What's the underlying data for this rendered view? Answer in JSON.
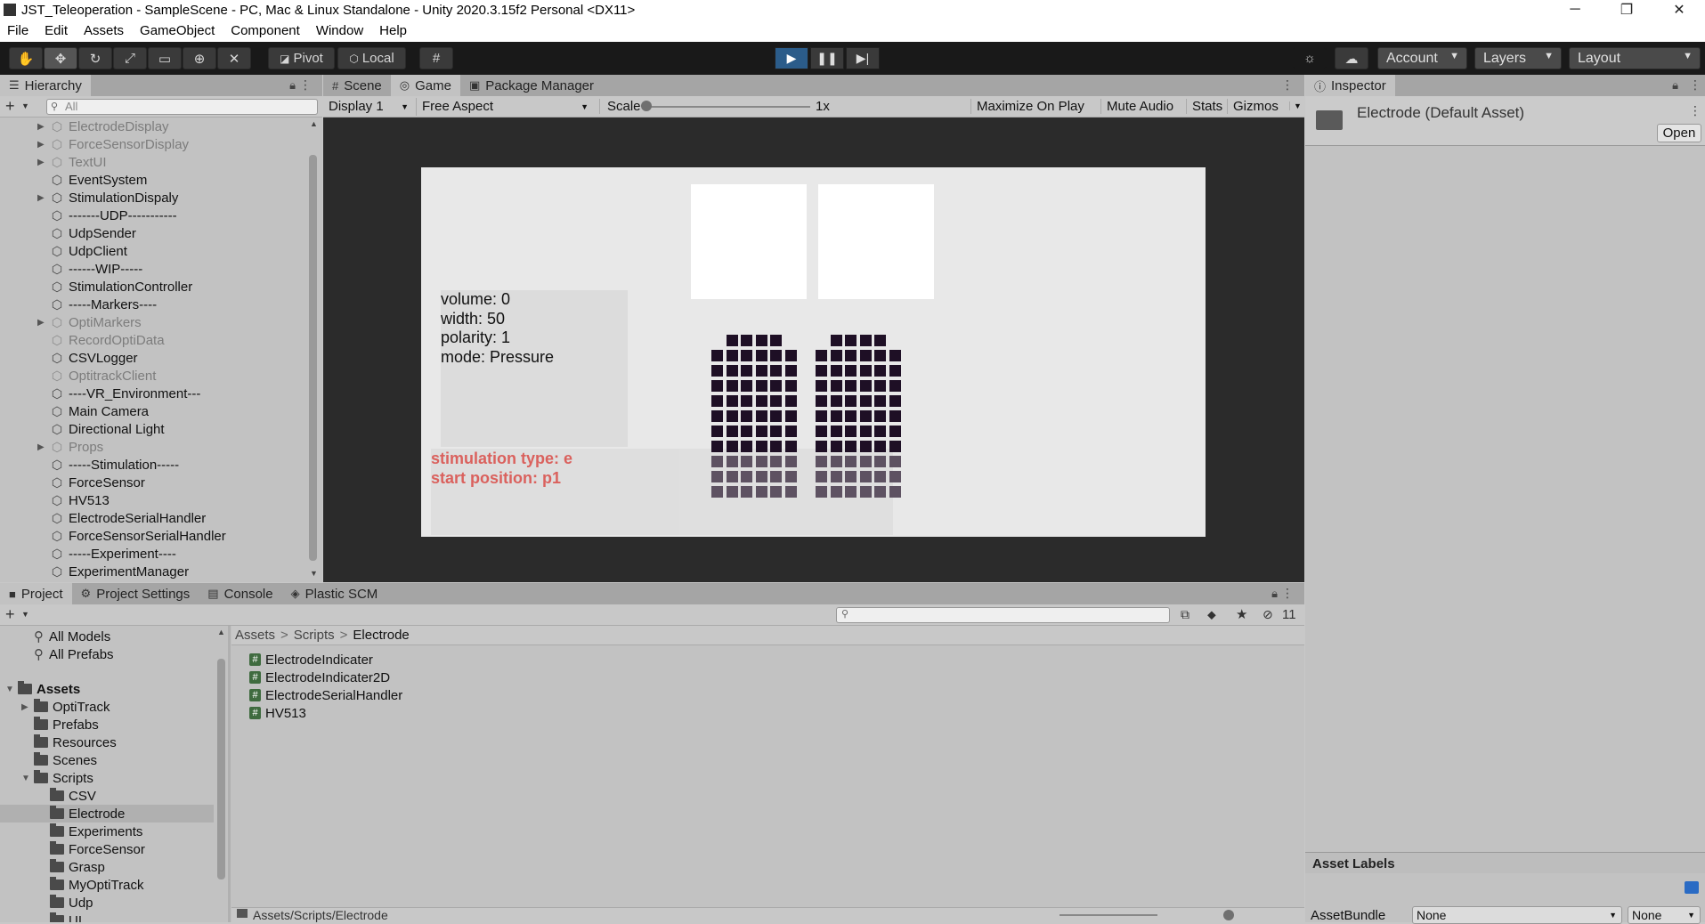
{
  "window": {
    "title": "JST_Teleoperation - SampleScene - PC, Mac & Linux Standalone - Unity 2020.3.15f2 Personal <DX11>",
    "minimize": "─",
    "maximize": "❐",
    "close": "✕"
  },
  "menu": [
    "File",
    "Edit",
    "Assets",
    "GameObject",
    "Component",
    "Window",
    "Help"
  ],
  "toolbar": {
    "pivot": "Pivot",
    "local": "Local",
    "account": "Account",
    "layers": "Layers",
    "layout": "Layout"
  },
  "hierarchy": {
    "tab": "Hierarchy",
    "search_placeholder": "All",
    "items": [
      {
        "label": "ElectrodeDisplay",
        "dim": true,
        "arrow": true
      },
      {
        "label": "ForceSensorDisplay",
        "dim": true,
        "arrow": true
      },
      {
        "label": "TextUI",
        "dim": true,
        "arrow": true
      },
      {
        "label": "EventSystem",
        "dim": false,
        "arrow": false
      },
      {
        "label": "StimulationDispaly",
        "dim": false,
        "arrow": true
      },
      {
        "label": "-------UDP-----------",
        "dim": false,
        "arrow": false
      },
      {
        "label": "UdpSender",
        "dim": false,
        "arrow": false
      },
      {
        "label": "UdpClient",
        "dim": false,
        "arrow": false
      },
      {
        "label": "------WIP-----",
        "dim": false,
        "arrow": false
      },
      {
        "label": "StimulationController",
        "dim": false,
        "arrow": false
      },
      {
        "label": "-----Markers----",
        "dim": false,
        "arrow": false
      },
      {
        "label": "OptiMarkers",
        "dim": true,
        "arrow": true
      },
      {
        "label": "RecordOptiData",
        "dim": true,
        "arrow": false
      },
      {
        "label": "CSVLogger",
        "dim": false,
        "arrow": false
      },
      {
        "label": "OptitrackClient",
        "dim": true,
        "arrow": false
      },
      {
        "label": "----VR_Environment---",
        "dim": false,
        "arrow": false
      },
      {
        "label": "Main Camera",
        "dim": false,
        "arrow": false
      },
      {
        "label": "Directional Light",
        "dim": false,
        "arrow": false
      },
      {
        "label": "Props",
        "dim": true,
        "arrow": true
      },
      {
        "label": "-----Stimulation-----",
        "dim": false,
        "arrow": false
      },
      {
        "label": "ForceSensor",
        "dim": false,
        "arrow": false
      },
      {
        "label": "HV513",
        "dim": false,
        "arrow": false
      },
      {
        "label": "ElectrodeSerialHandler",
        "dim": false,
        "arrow": false
      },
      {
        "label": "ForceSensorSerialHandler",
        "dim": false,
        "arrow": false
      },
      {
        "label": "-----Experiment----",
        "dim": false,
        "arrow": false
      },
      {
        "label": "ExperimentManager",
        "dim": false,
        "arrow": false
      }
    ]
  },
  "game": {
    "tabs": [
      "Scene",
      "Game",
      "Package Manager"
    ],
    "display": "Display 1",
    "aspect": "Free Aspect",
    "scale_label": "Scale",
    "scale_value": "1x",
    "maximize": "Maximize On Play",
    "mute": "Mute Audio",
    "stats": "Stats",
    "gizmos": "Gizmos",
    "info": {
      "volume": "volume: 0",
      "width": "width: 50",
      "polarity": "polarity: 1",
      "mode": "mode: Pressure"
    },
    "stim": {
      "type": "stimulation type: e",
      "start": "start position: p1"
    }
  },
  "inspector": {
    "tab": "Inspector",
    "asset": "Electrode (Default Asset)",
    "open": "Open",
    "asset_labels": "Asset Labels",
    "assetbundle": "AssetBundle",
    "none1": "None",
    "none2": "None"
  },
  "project": {
    "tabs": [
      "Project",
      "Project Settings",
      "Console",
      "Plastic SCM"
    ],
    "hidden_count": "11",
    "favorites": [
      "All Models",
      "All Prefabs"
    ],
    "tree": [
      {
        "label": "Assets",
        "level": 0,
        "arrow": "▼",
        "bold": true
      },
      {
        "label": "OptiTrack",
        "level": 1,
        "arrow": "▶"
      },
      {
        "label": "Prefabs",
        "level": 1,
        "arrow": ""
      },
      {
        "label": "Resources",
        "level": 1,
        "arrow": ""
      },
      {
        "label": "Scenes",
        "level": 1,
        "arrow": ""
      },
      {
        "label": "Scripts",
        "level": 1,
        "arrow": "▼"
      },
      {
        "label": "CSV",
        "level": 2,
        "arrow": ""
      },
      {
        "label": "Electrode",
        "level": 2,
        "arrow": "",
        "selected": true
      },
      {
        "label": "Experiments",
        "level": 2,
        "arrow": ""
      },
      {
        "label": "ForceSensor",
        "level": 2,
        "arrow": ""
      },
      {
        "label": "Grasp",
        "level": 2,
        "arrow": ""
      },
      {
        "label": "MyOptiTrack",
        "level": 2,
        "arrow": ""
      },
      {
        "label": "Udp",
        "level": 2,
        "arrow": ""
      },
      {
        "label": "UI",
        "level": 2,
        "arrow": ""
      }
    ],
    "breadcrumb": [
      "Assets",
      "Scripts",
      "Electrode"
    ],
    "files": [
      "ElectrodeIndicater",
      "ElectrodeIndicater2D",
      "ElectrodeSerialHandler",
      "HV513"
    ],
    "path": "Assets/Scripts/Electrode"
  }
}
